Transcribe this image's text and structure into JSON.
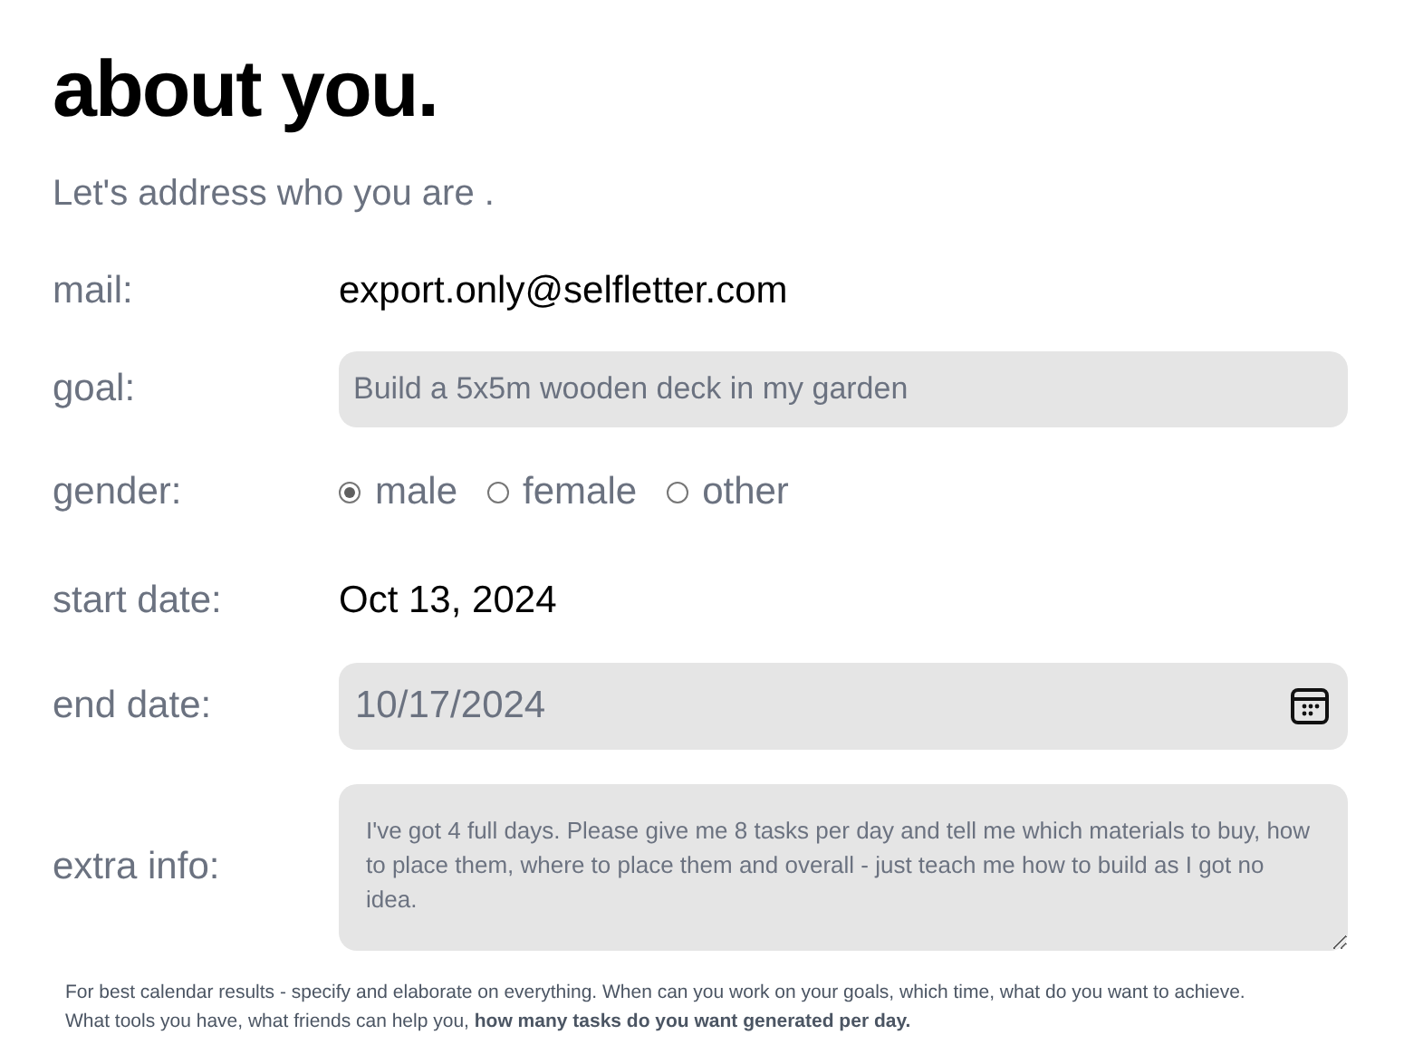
{
  "heading": "about you.",
  "subtitle": "Let's address who you are .",
  "fields": [
    {
      "kind": "text",
      "label": "mail:",
      "value": "export.only@selfletter.com"
    },
    {
      "kind": "input",
      "label": "goal:",
      "placeholder": "Build a 5x5m wooden deck in my garden"
    },
    {
      "kind": "radio",
      "label": "gender:",
      "options": [
        {
          "label": "male",
          "selected": true
        },
        {
          "label": "female",
          "selected": false
        },
        {
          "label": "other",
          "selected": false
        }
      ]
    },
    {
      "kind": "text",
      "label": "start date:",
      "value": "Oct 13, 2024"
    },
    {
      "kind": "date",
      "label": "end date:",
      "value": "10/17/2024"
    },
    {
      "kind": "textarea",
      "label": "extra info:",
      "value": "I've got 4 full days. Please give me 8 tasks per day and tell me which materials to buy, how to place them, where to place them and overall - just teach me how to build as I got no idea."
    }
  ],
  "note": "For best calendar results - specify and elaborate on everything. When can you work on your goals, which time, what do you want to achieve. What tools you have, what friends can help you, **how many tasks do you want generated per day.**"
}
